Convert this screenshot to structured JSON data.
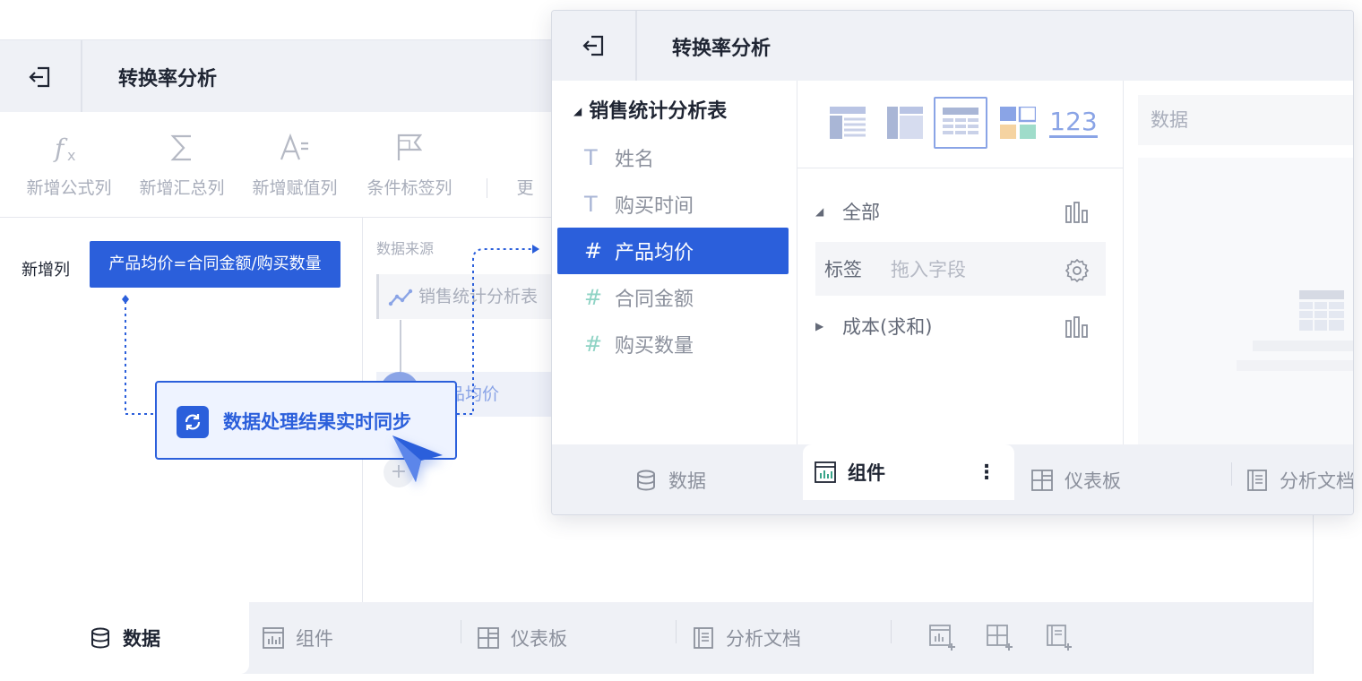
{
  "back_window": {
    "title": "转换率分析",
    "toolbar": [
      {
        "label": "新增公式列",
        "icon": "fx-icon"
      },
      {
        "label": "新增汇总列",
        "icon": "sigma-icon"
      },
      {
        "label": "新增赋值列",
        "icon": "assign-icon"
      },
      {
        "label": "条件标签列",
        "icon": "flag-icon"
      }
    ],
    "toolbar_more": "更",
    "new_column_label": "新增列",
    "formula": "产品均价=合同金额/购买数量",
    "data_source_label": "数据来源",
    "source_item": "销售统计分析表",
    "source_item2": "品均价",
    "plus": "+",
    "callout": "数据处理结果实时同步",
    "bottom_tabs": [
      "数据",
      "组件",
      "仪表板",
      "分析文档"
    ]
  },
  "front_window": {
    "title": "转换率分析",
    "dataset": {
      "name": "销售统计分析表",
      "fields": [
        {
          "label": "姓名",
          "type_glyph": "T",
          "selected": false
        },
        {
          "label": "购买时间",
          "type_glyph": "T",
          "selected": false
        },
        {
          "label": "产品均价",
          "type_glyph": "#",
          "selected": true
        },
        {
          "label": "合同金额",
          "type_glyph": "#",
          "selected": false
        },
        {
          "label": "购买数量",
          "type_glyph": "#",
          "selected": false
        }
      ]
    },
    "chart_types": [
      "table-icon",
      "cross-table-icon",
      "detail-table-icon",
      "grid-icon"
    ],
    "kpi_text": "123",
    "props": {
      "all_label": "全部",
      "tag_label": "标签",
      "tag_placeholder": "拖入字段",
      "measure_label": "成本(求和)"
    },
    "preview_label": "数据",
    "bottom_tabs": [
      "数据",
      "组件",
      "仪表板",
      "分析文档"
    ],
    "more_glyph": "⋮"
  },
  "colors": {
    "accent": "#2b5fdb",
    "accent_light": "#8aa4e6",
    "bar_bg": "#eff1f6"
  }
}
